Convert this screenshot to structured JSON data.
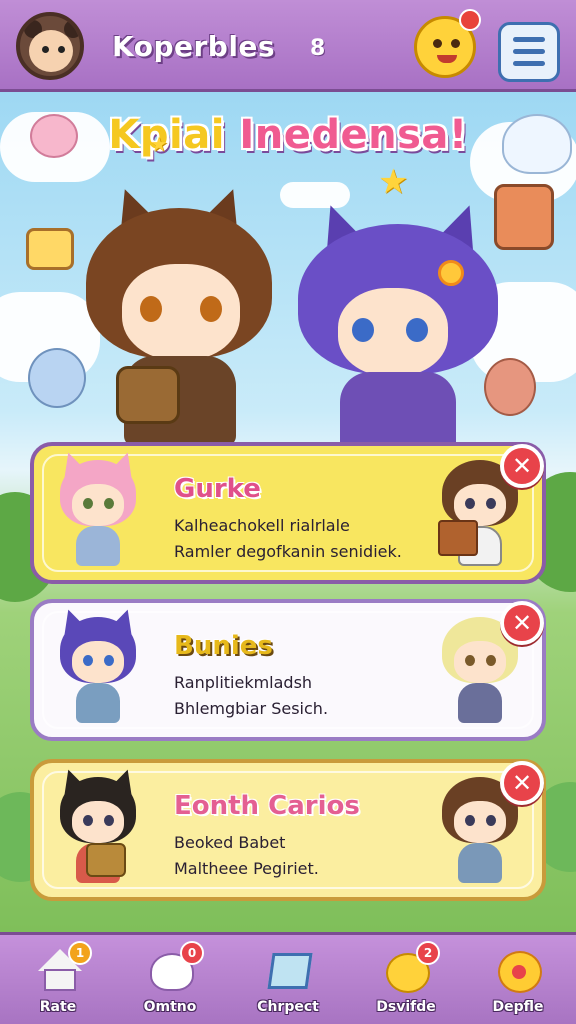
{
  "header": {
    "title": "Koperbles",
    "count": "8"
  },
  "banner": {
    "title_part1": "Kpiai",
    "title_part2": "Inedensa!"
  },
  "cards": [
    {
      "name": "Gurke",
      "line1": "Kalheachokell rialrlale",
      "line2": "Ramler degofkanin senidiek.",
      "close": "✕"
    },
    {
      "name": "Bunies",
      "line1": "Ranplitiekmladsh",
      "line2": "Bhlemgbiar Sesich.",
      "close": "✕"
    },
    {
      "name": "Eonth Carios",
      "line1": "Beoked Babet",
      "line2": "Maltheee Pegiriet.",
      "close": "✕"
    }
  ],
  "nav": [
    {
      "label": "Rate",
      "badge": "1",
      "icon": "home-icon"
    },
    {
      "label": "Omtno",
      "badge": "0",
      "icon": "ghost-icon"
    },
    {
      "label": "Chrpect",
      "badge": "",
      "icon": "map-icon"
    },
    {
      "label": "Dsvifde",
      "badge": "2",
      "icon": "chick-icon"
    },
    {
      "label": "Depfle",
      "badge": "",
      "icon": "profile-mascot-icon"
    }
  ],
  "colors": {
    "header_bg": "#b57fcf",
    "accent_pink": "#f05b91",
    "accent_yellow": "#f5c820",
    "close_red": "#e8434a"
  }
}
